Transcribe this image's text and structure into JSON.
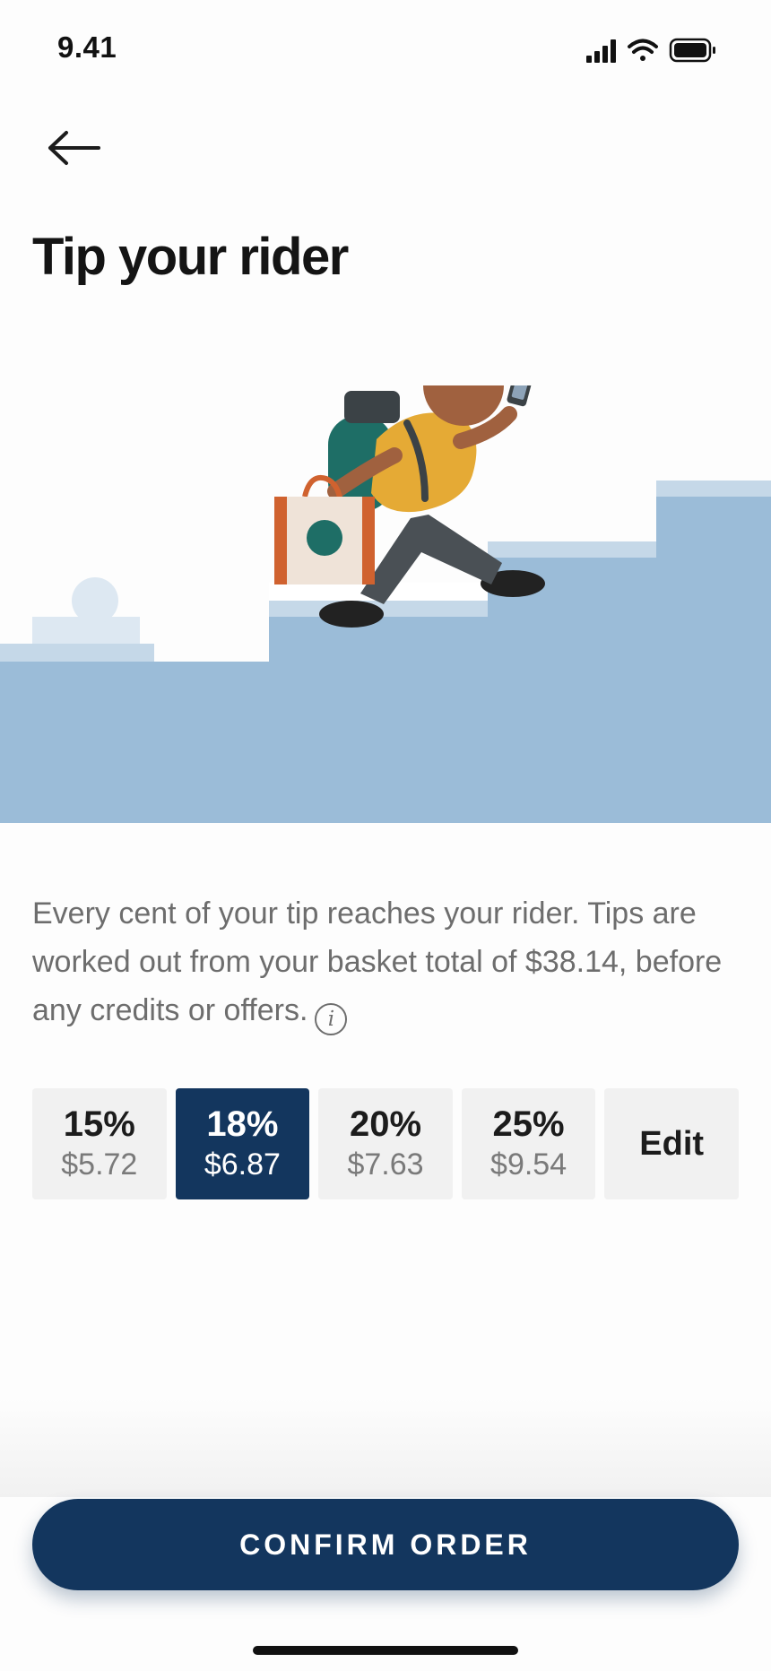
{
  "status_bar": {
    "time": "9.41"
  },
  "header": {
    "title": "Tip your rider"
  },
  "description": {
    "text": "Every cent of your tip reaches your rider. Tips are worked out from your basket total of $38.14, before any credits or offers.",
    "info_icon_glyph": "i"
  },
  "tip_options": [
    {
      "percent": "15%",
      "amount": "$5.72",
      "selected": false
    },
    {
      "percent": "18%",
      "amount": "$6.87",
      "selected": true
    },
    {
      "percent": "20%",
      "amount": "$7.63",
      "selected": false
    },
    {
      "percent": "25%",
      "amount": "$9.54",
      "selected": false
    }
  ],
  "edit_label": "Edit",
  "confirm_button": {
    "label": "CONFIRM ORDER"
  },
  "colors": {
    "primary": "#13365e",
    "sky_light": "#dde8f2",
    "sky_mid": "#c5d8e8",
    "sky_dark": "#9bbcd8",
    "rider_skin": "#a0613f",
    "rider_shirt": "#e5aa35",
    "rider_bag": "#1e6e66",
    "shopping_bag_accent": "#d0622f"
  },
  "icons": {
    "back": "arrow-left-icon",
    "signal": "cellular-signal-icon",
    "wifi": "wifi-icon",
    "battery": "battery-icon",
    "info": "info-icon"
  }
}
